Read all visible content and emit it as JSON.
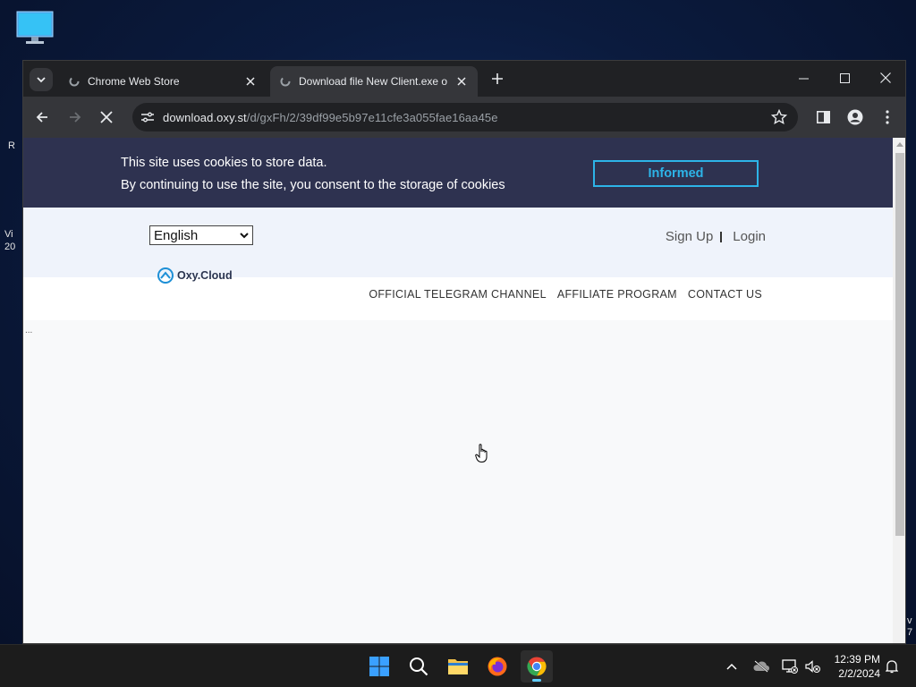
{
  "browser": {
    "tabs": [
      {
        "title": "Chrome Web Store",
        "active": false
      },
      {
        "title": "Download file New Client.exe o",
        "active": true
      }
    ],
    "url_host": "download.oxy.st",
    "url_path": "/d/gxFh/2/39df99e5b97e11cfe3a055fae16aa45e"
  },
  "page": {
    "cookie_line1": "This site uses cookies to store data.",
    "cookie_line2": "By continuing to use the site, you consent to the storage of cookies",
    "cookie_button": "Informed",
    "language": "English",
    "sign_up": "Sign Up",
    "login": "Login",
    "logo_text": "Oxy.Cloud",
    "nav": [
      "OFFICIAL TELEGRAM CHANNEL",
      "AFFILIATE PROGRAM",
      "CONTACT US"
    ],
    "loading_text": "..."
  },
  "desktop_edge": {
    "left_top": "R",
    "left_mid1": "Vi",
    "left_mid2": "20",
    "right_bottom1": "v",
    "right_bottom2": "7"
  },
  "taskbar": {
    "apps": [
      "start-icon",
      "search-icon",
      "file-explorer-icon",
      "firefox-icon",
      "chrome-icon"
    ],
    "time": "12:39 PM",
    "date": "2/2/2024"
  },
  "colors": {
    "cookie_bg": "#2e3250",
    "accent": "#2db4e8",
    "header_bg": "#eff3fb"
  }
}
